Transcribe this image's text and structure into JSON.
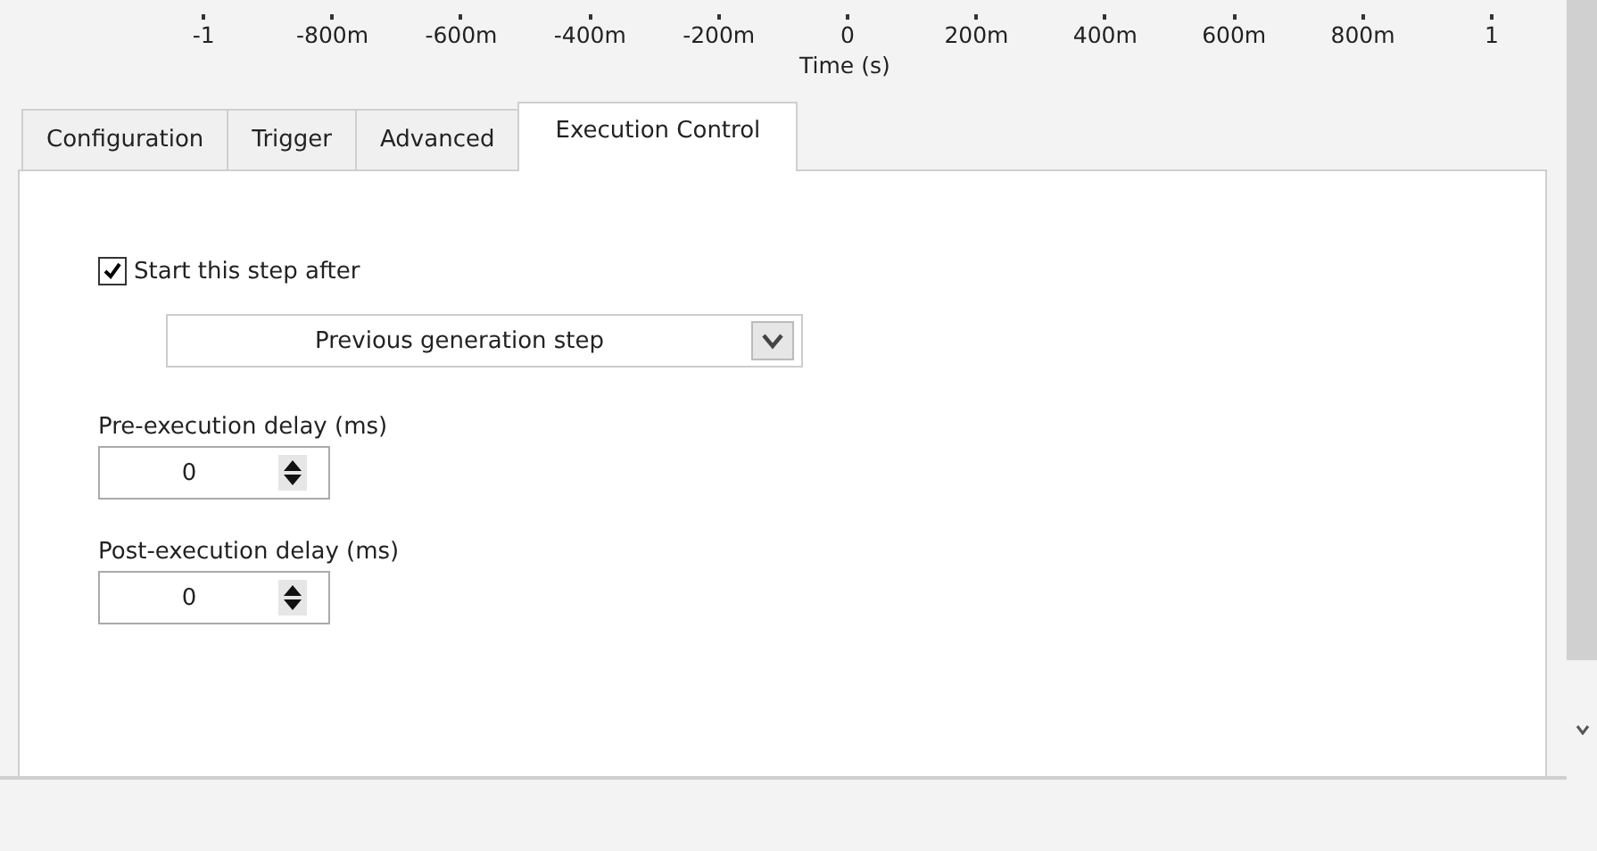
{
  "axis": {
    "ticks": [
      "-1",
      "-800m",
      "-600m",
      "-400m",
      "-200m",
      "0",
      "200m",
      "400m",
      "600m",
      "800m",
      "1"
    ],
    "title": "Time (s)"
  },
  "tabs": [
    {
      "label": "Configuration",
      "selected": false
    },
    {
      "label": "Trigger",
      "selected": false
    },
    {
      "label": "Advanced",
      "selected": false
    },
    {
      "label": "Execution Control",
      "selected": true
    }
  ],
  "start_after": {
    "label": "Start this step after",
    "checked": true,
    "value": "Previous generation step"
  },
  "delays": [
    {
      "label": "Pre-execution delay (ms)",
      "value": "0"
    },
    {
      "label": "Post-execution delay (ms)",
      "value": "0"
    }
  ]
}
